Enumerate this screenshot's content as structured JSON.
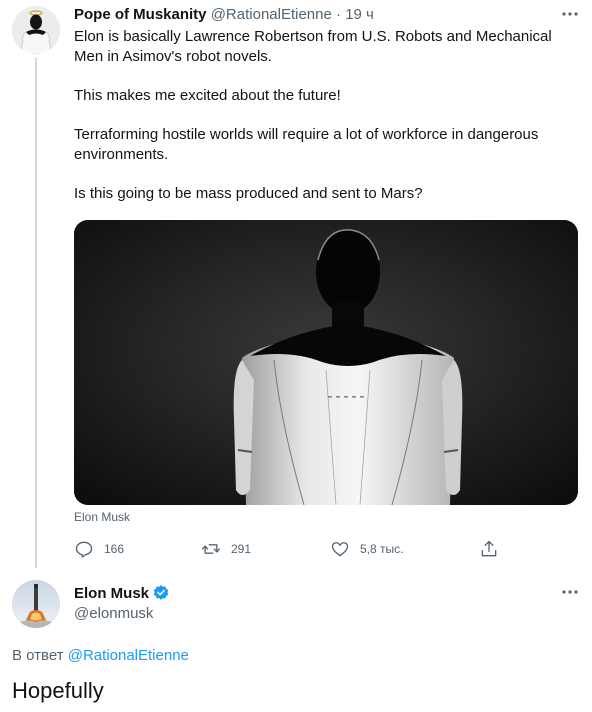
{
  "original_tweet": {
    "author_name": "Pope of Muskanity",
    "author_handle": "@RationalEtienne",
    "separator": "·",
    "time": "19 ч",
    "more_icon": "ellipsis-icon",
    "paragraphs": [
      "Elon is basically Lawrence Robertson from U.S. Robots and Mechanical Men in Asimov's robot novels.",
      "This makes me excited about the future!",
      "Terraforming hostile worlds will require a lot of workforce in dangerous environments.",
      "Is this going to be mass produced and sent to Mars?"
    ],
    "media_caption": "Elon Musk",
    "actions": {
      "replies": "166",
      "retweets": "291",
      "likes": "5,8 тыс.",
      "reply_icon": "reply-icon",
      "retweet_icon": "retweet-icon",
      "like_icon": "heart-icon",
      "share_icon": "share-icon"
    }
  },
  "reply_tweet": {
    "author_name": "Elon Musk",
    "author_handle": "@elonmusk",
    "verified_icon": "verified-badge-icon",
    "replying_to_prefix": "В ответ",
    "replying_to_handle": "@RationalEtienne",
    "text": "Hopefully"
  },
  "colors": {
    "text": "#0f1419",
    "secondary": "#536471",
    "link": "#1d9bf0",
    "thread_line": "#cfd9de"
  }
}
